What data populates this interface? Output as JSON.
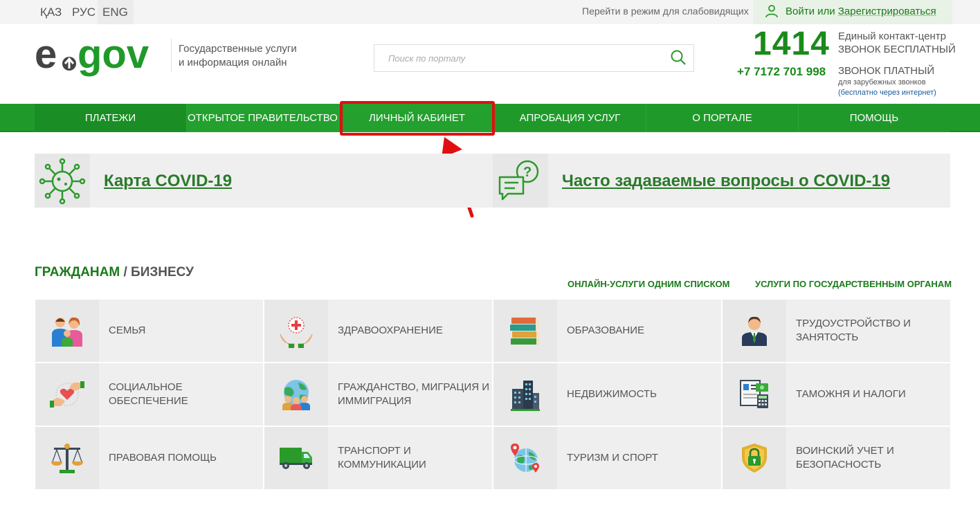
{
  "topbar": {
    "languages": [
      "ҚАЗ",
      "РУС",
      "ENG"
    ],
    "impaired_mode": "Перейти в режим для слабовидящих",
    "login_prefix": "Войти или ",
    "register": "Зарегистрироваться"
  },
  "header": {
    "logo": "egov",
    "tagline_line1": "Государственные услуги",
    "tagline_line2": "и информация онлайн",
    "search_placeholder": "Поиск по порталу",
    "contact_number": "1414",
    "contact_title": "Единый контакт-центр",
    "contact_free": "ЗВОНОК БЕСПЛАТНЫЙ",
    "phone_paid": "+7 7172 701 998",
    "contact_paid": "ЗВОНОК ПЛАТНЫЙ",
    "contact_foreign": "для зарубежных звонков",
    "contact_internet": "(бесплатно через интернет)"
  },
  "nav": {
    "items": [
      "ПЛАТЕЖИ",
      "ОТКРЫТОЕ ПРАВИТЕЛЬСТВО",
      "ЛИЧНЫЙ КАБИНЕТ",
      "АПРОБАЦИЯ УСЛУГ",
      "О ПОРТАЛЕ",
      "ПОМОЩЬ"
    ],
    "highlighted_index": 2
  },
  "covid": {
    "map_label": "Карта COVID-19",
    "faq_label": "Часто задаваемые вопросы о COVID-19"
  },
  "sections": {
    "citizens": "ГРАЖДАНАМ",
    "separator": "/",
    "business": "БИЗНЕСУ",
    "online_list": "ОНЛАЙН-УСЛУГИ ОДНИМ СПИСКОМ",
    "by_agencies": "УСЛУГИ ПО ГОСУДАРСТВЕННЫМ ОРГАНАМ"
  },
  "categories": [
    {
      "label": "Семья",
      "icon": "family-icon"
    },
    {
      "label": "Здравоохранение",
      "icon": "health-icon"
    },
    {
      "label": "Образование",
      "icon": "books-icon"
    },
    {
      "label": "Трудоустройство и занятость",
      "icon": "worker-icon"
    },
    {
      "label": "Социальное обеспечение",
      "icon": "social-care-icon"
    },
    {
      "label": "Гражданство, миграция и иммиграция",
      "icon": "globe-people-icon"
    },
    {
      "label": "Недвижимость",
      "icon": "buildings-icon"
    },
    {
      "label": "Таможня и налоги",
      "icon": "tax-document-icon"
    },
    {
      "label": "Правовая помощь",
      "icon": "scales-icon"
    },
    {
      "label": "Транспорт и коммуникации",
      "icon": "truck-icon"
    },
    {
      "label": "Туризм и спорт",
      "icon": "travel-globe-icon"
    },
    {
      "label": "Воинский учет и безопасность",
      "icon": "shield-lock-icon"
    }
  ],
  "colors": {
    "brand_green": "#1f9a2a",
    "highlight_red": "#e01010"
  }
}
